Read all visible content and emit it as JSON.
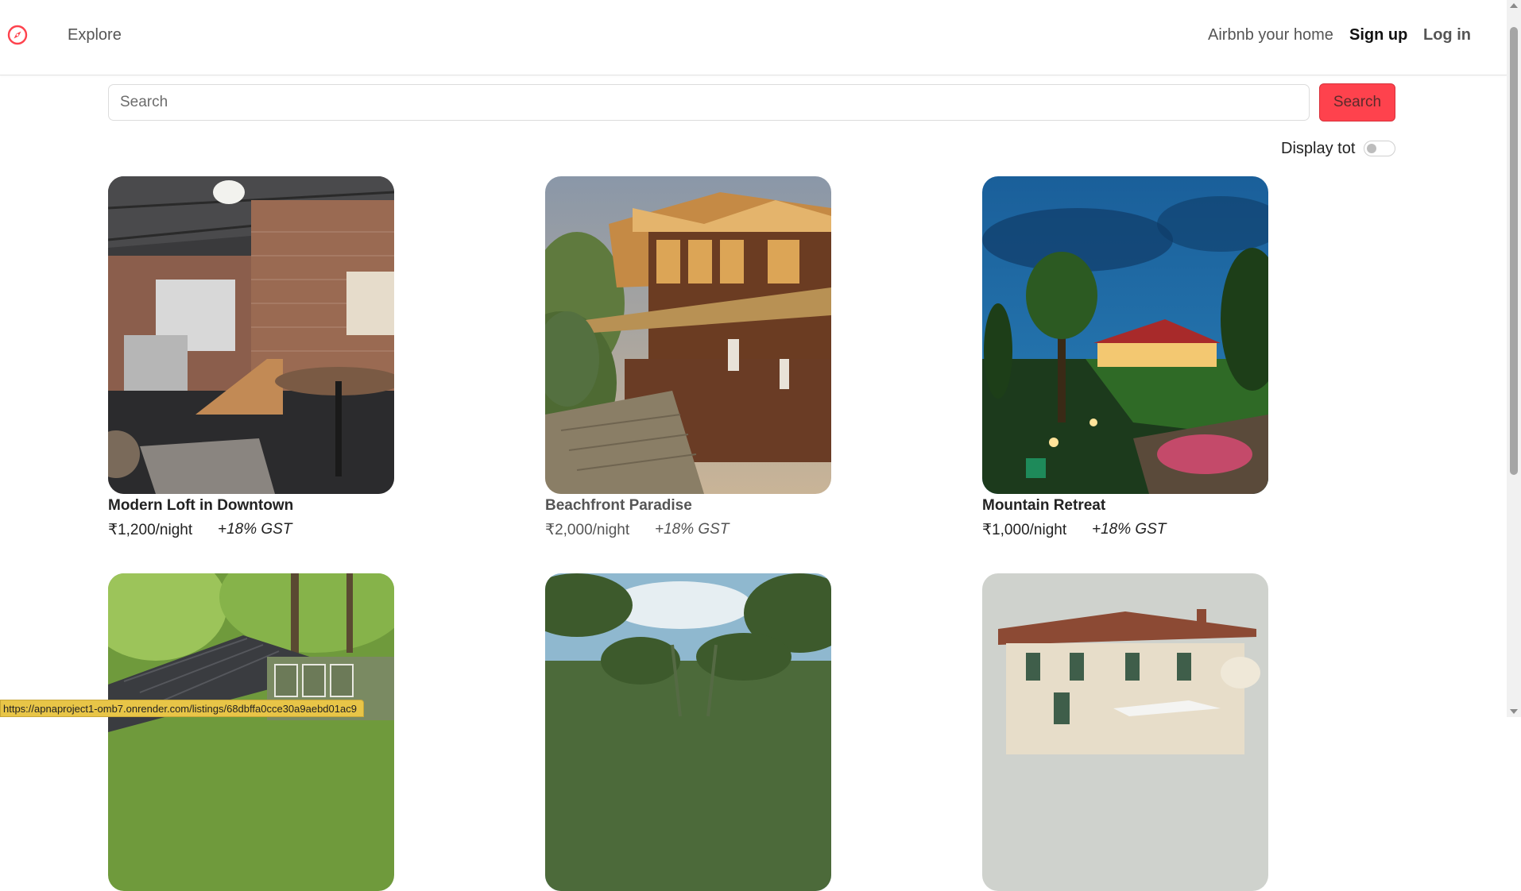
{
  "navbar": {
    "explore_label": "Explore",
    "host_label": "Airbnb your home",
    "signup_label": "Sign up",
    "login_label": "Log in",
    "brand_icon": "compass-icon",
    "brand_color": "#fe424d"
  },
  "search": {
    "placeholder": "Search",
    "value": "",
    "button_label": "Search",
    "button_color": "#fe424d"
  },
  "tax_toggle": {
    "label": "Display tot",
    "checked": false
  },
  "listings": [
    {
      "title": "Modern Loft in Downtown",
      "price": "₹1,200/night",
      "gst": "+18% GST",
      "image": "loft-interior"
    },
    {
      "title": "Beachfront Paradise",
      "price": "₹2,000/night",
      "gst": "+18% GST",
      "image": "beach-lodge-terrace"
    },
    {
      "title": "Mountain Retreat",
      "price": "₹1,000/night",
      "gst": "+18% GST",
      "image": "mountain-garden-night"
    },
    {
      "title": "",
      "price": "",
      "gst": "",
      "image": "cabin-in-forest"
    },
    {
      "title": "",
      "price": "",
      "gst": "",
      "image": "palm-grove"
    },
    {
      "title": "",
      "price": "",
      "gst": "",
      "image": "italian-villa"
    }
  ],
  "status_bar": {
    "url": "https://apnaproject1-omb7.onrender.com/listings/68dbffa0cce30a9aebd01ac9"
  }
}
